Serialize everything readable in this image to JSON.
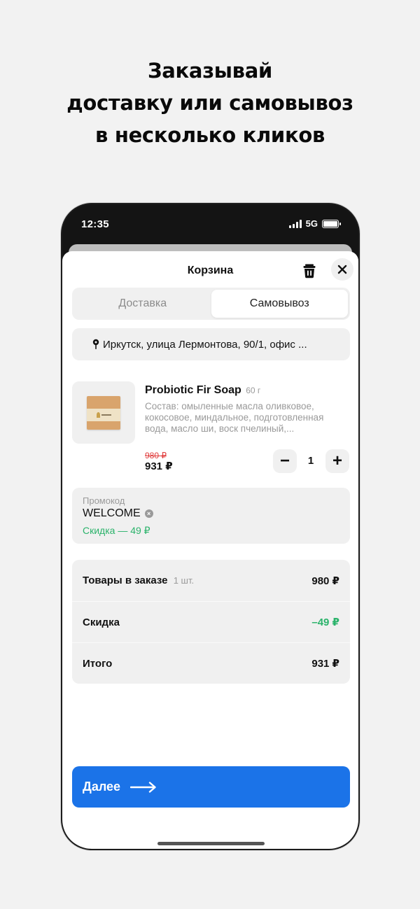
{
  "headline": {
    "line1": "Заказывай",
    "line2": "доставку или самовывоз",
    "line3": "в несколько кликов"
  },
  "status_bar": {
    "time": "12:35",
    "network": "5G"
  },
  "cart": {
    "title": "Корзина",
    "tabs": [
      {
        "label": "Доставка",
        "active": false
      },
      {
        "label": "Самовывоз",
        "active": true
      }
    ],
    "address": "Иркутск, улица Лермонтова, 90/1, офис ...",
    "product": {
      "name": "Probiotic Fir Soap",
      "weight": "60 г",
      "description": "Состав: омыленные масла оливковое, кокосовое, миндальное, подготовленная вода, масло ши, воск пчелиный,...",
      "old_price": "980 ₽",
      "price": "931 ₽",
      "quantity": "1",
      "minus_label": "−",
      "plus_label": "+"
    },
    "promo": {
      "label": "Промокод",
      "code": "WELCOME",
      "discount_text": "Скидка — 49 ₽"
    },
    "summary": {
      "items_label": "Товары в заказе",
      "items_count": "1 шт.",
      "items_value": "980 ₽",
      "discount_label": "Скидка",
      "discount_value": "–49 ₽",
      "total_label": "Итого",
      "total_value": "931 ₽"
    },
    "next_button": "Далее"
  },
  "colors": {
    "accent": "#1b73e8",
    "discount": "#2bb36b",
    "old_price": "#e03b3b"
  }
}
